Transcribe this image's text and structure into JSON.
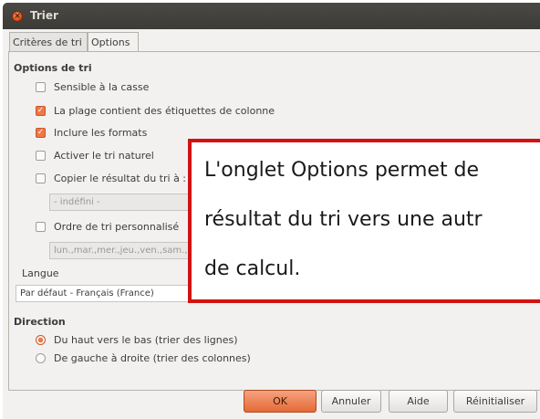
{
  "window": {
    "title": "Trier"
  },
  "tabs": [
    {
      "label": "Critères de tri"
    },
    {
      "label": "Options"
    }
  ],
  "options": {
    "section_title": "Options de tri",
    "items": [
      {
        "label": "Sensible à la casse",
        "checked": false
      },
      {
        "label": "La plage contient des étiquettes de colonne",
        "checked": true
      },
      {
        "label": "Inclure les formats",
        "checked": true
      },
      {
        "label": "Activer le tri naturel",
        "checked": false
      },
      {
        "label": "Copier le résultat du tri à :",
        "checked": false
      },
      {
        "label": "Ordre de tri personnalisé",
        "checked": false
      }
    ],
    "copy_target_value": "- indéfini -",
    "custom_order_value": "lun.,mar.,mer.,jeu.,ven.,sam.,dim."
  },
  "language": {
    "label": "Langue",
    "value": "Par défaut - Français (France)"
  },
  "direction": {
    "section_title": "Direction",
    "options": [
      {
        "label": "Du haut vers le bas (trier des lignes)",
        "selected": true
      },
      {
        "label": "De gauche à droite (trier des colonnes)",
        "selected": false
      }
    ]
  },
  "buttons": {
    "ok": "OK",
    "cancel": "Annuler",
    "help": "Aide",
    "reset": "Réinitialiser"
  },
  "callout": {
    "line1": "L'onglet Options permet de",
    "line2": "résultat du tri vers une autr",
    "line3": "de calcul."
  },
  "colors": {
    "accent": "#f07746",
    "callout_border": "#d01312",
    "titlebar": "#3c3b37"
  }
}
